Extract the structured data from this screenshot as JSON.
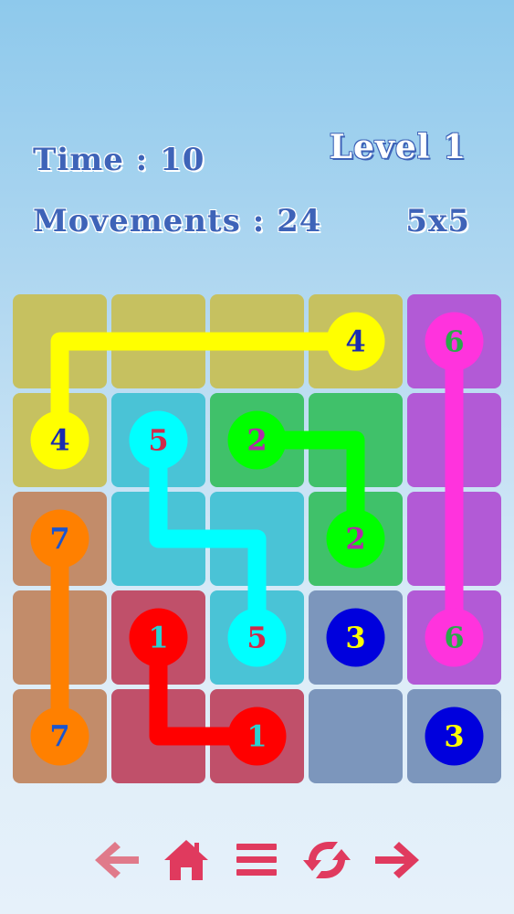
{
  "hud": {
    "time_text": "Time : 10",
    "movements_text": "Movements : 24",
    "level_text": "Level 1",
    "grid_size_text": "5x5"
  },
  "board": {
    "rows": 5,
    "cols": 5,
    "cells": [
      [
        "#c6c160",
        "#c6c160",
        "#c6c160",
        "#c6c160",
        "#b25ad6"
      ],
      [
        "#c6c160",
        "#4ac3d6",
        "#40c16a",
        "#40c16a",
        "#b25ad6"
      ],
      [
        "#c28c6a",
        "#4ac3d6",
        "#4ac3d6",
        "#40c16a",
        "#b25ad6"
      ],
      [
        "#c28c6a",
        "#c0506a",
        "#4ac3d6",
        "#7c96bc",
        "#b25ad6"
      ],
      [
        "#c28c6a",
        "#c0506a",
        "#c0506a",
        "#7c96bc",
        "#7c96bc"
      ]
    ],
    "paths": [
      {
        "number": "4",
        "color": "#ffff00",
        "text_color": "#1a2bb0",
        "cells": [
          [
            3,
            0
          ],
          [
            0,
            0
          ],
          [
            0,
            1
          ]
        ],
        "endpoints": [
          [
            3,
            0
          ],
          [
            0,
            1
          ]
        ]
      },
      {
        "number": "6",
        "color": "#ff33dd",
        "text_color": "#2aa84a",
        "cells": [
          [
            4,
            0
          ],
          [
            4,
            3
          ]
        ],
        "endpoints": [
          [
            4,
            0
          ],
          [
            4,
            3
          ]
        ]
      },
      {
        "number": "5",
        "color": "#00ffff",
        "text_color": "#d02a4a",
        "cells": [
          [
            1,
            1
          ],
          [
            1,
            2
          ],
          [
            2,
            2
          ],
          [
            2,
            3
          ]
        ],
        "endpoints": [
          [
            1,
            1
          ],
          [
            2,
            3
          ]
        ]
      },
      {
        "number": "2",
        "color": "#00ff00",
        "text_color": "#b02aa8",
        "cells": [
          [
            2,
            1
          ],
          [
            3,
            1
          ],
          [
            3,
            2
          ]
        ],
        "endpoints": [
          [
            2,
            1
          ],
          [
            3,
            2
          ]
        ]
      },
      {
        "number": "7",
        "color": "#ff8000",
        "text_color": "#1a55d0",
        "cells": [
          [
            0,
            2
          ],
          [
            0,
            4
          ]
        ],
        "endpoints": [
          [
            0,
            2
          ],
          [
            0,
            4
          ]
        ]
      },
      {
        "number": "1",
        "color": "#ff0000",
        "text_color": "#2ad0d0",
        "cells": [
          [
            1,
            3
          ],
          [
            1,
            4
          ],
          [
            2,
            4
          ]
        ],
        "endpoints": [
          [
            1,
            3
          ],
          [
            2,
            4
          ]
        ]
      },
      {
        "number": "3",
        "color": "#0000dd",
        "text_color": "#ffff00",
        "cells": [],
        "endpoints": [
          [
            3,
            3
          ],
          [
            4,
            4
          ]
        ]
      }
    ]
  },
  "toolbar": {
    "icon_color": "#e03a5e",
    "back_color": "#e07a8a",
    "buttons": [
      {
        "name": "back-button",
        "icon": "arrow-left-icon"
      },
      {
        "name": "home-button",
        "icon": "home-icon"
      },
      {
        "name": "menu-button",
        "icon": "menu-icon"
      },
      {
        "name": "restart-button",
        "icon": "refresh-icon"
      },
      {
        "name": "next-button",
        "icon": "arrow-right-icon"
      }
    ]
  }
}
